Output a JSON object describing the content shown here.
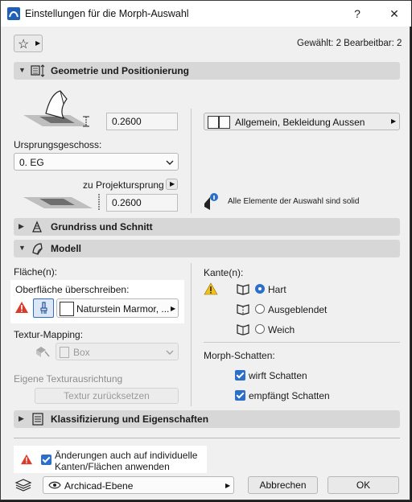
{
  "window": {
    "title": "Einstellungen für die Morph-Auswahl",
    "help": "?",
    "close": "✕"
  },
  "header": {
    "selection_info": "Gewählt: 2 Bearbeitbar: 2"
  },
  "sections": {
    "geometry": "Geometrie und Positionierung",
    "floorplan": "Grundriss und Schnitt",
    "model": "Modell",
    "classification": "Klassifizierung und Eigenschaften"
  },
  "geometry": {
    "height_value": "0.2600",
    "home_story_label": "Ursprungsgeschoss:",
    "home_story_value": "0. EG",
    "offset_label": "zu Projektursprung",
    "offset_value": "0.2600",
    "building_material": "Allgemein, Bekleidung Aussen",
    "solid_info": "Alle Elemente der Auswahl sind solid"
  },
  "model": {
    "faces_label": "Fläche(n):",
    "override_label": "Oberfläche überschreiben:",
    "surface_value": "Naturstein Marmor, ...",
    "texture_mapping_label": "Textur-Mapping:",
    "texture_mapping_value": "Box",
    "own_texture_label": "Eigene Texturausrichtung",
    "reset_texture_button": "Textur zurücksetzen",
    "edges_label": "Kante(n):",
    "edge_options": [
      "Hart",
      "Ausgeblendet",
      "Weich"
    ],
    "shadow_label": "Morph-Schatten:",
    "casts_shadow": "wirft Schatten",
    "receives_shadow": "empfängt Schatten"
  },
  "footer": {
    "apply_edges_line1": "Änderungen auch auf individuelle",
    "apply_edges_line2": "Kanten/Flächen anwenden",
    "layer_value": "Archicad-Ebene",
    "cancel": "Abbrechen",
    "ok": "OK"
  },
  "colors": {
    "accent": "#2b6fcb",
    "warning": "#d83b2b",
    "section_bg": "#d7d7d7"
  }
}
